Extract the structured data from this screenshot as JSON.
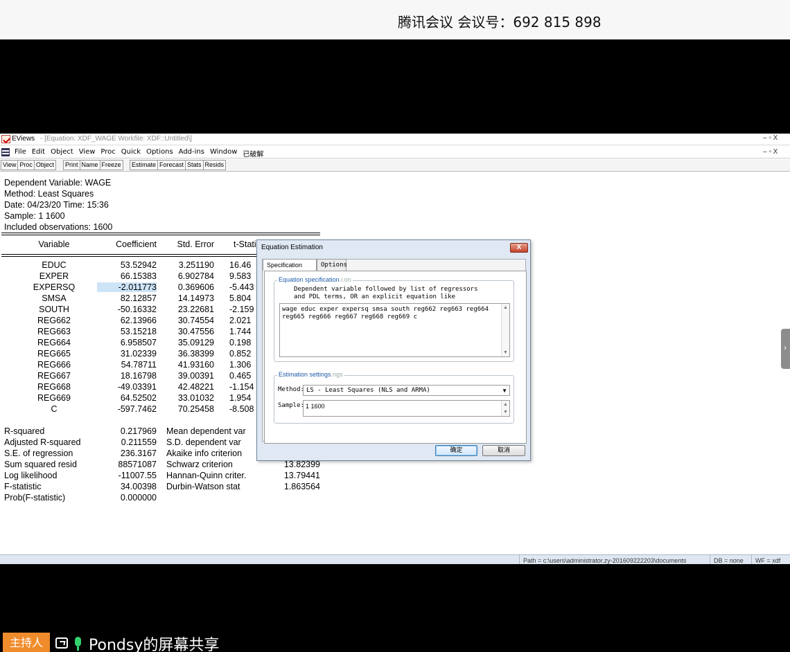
{
  "meeting": {
    "title": "腾讯会议 会议号：692 815 898"
  },
  "window": {
    "app_name": "EViews",
    "title_rest": " - [Equation: XDF_WAGE   Workfile: XDF::Untitled\\]",
    "app_controls": "–  ▫  X",
    "doc_controls": "–  ▫  X"
  },
  "menu": [
    "File",
    "Edit",
    "Object",
    "View",
    "Proc",
    "Quick",
    "Options",
    "Add-ins",
    "Window",
    "已破解"
  ],
  "toolbar": {
    "group1": [
      "View",
      "Proc",
      "Object"
    ],
    "group2": [
      "Print",
      "Name",
      "Freeze"
    ],
    "group3": [
      "Estimate",
      "Forecast",
      "Stats",
      "Resids"
    ]
  },
  "output": {
    "header": [
      "Dependent Variable: WAGE",
      "Method: Least Squares",
      "Date: 04/23/20   Time: 15:36",
      "Sample: 1 1600",
      "Included observations: 1600"
    ],
    "col_headers": [
      "Variable",
      "Coefficient",
      "Std. Error",
      "t-Stati"
    ],
    "rows": [
      [
        "EDUC",
        "53.52942",
        "3.251190",
        "16.46"
      ],
      [
        "EXPER",
        "66.15383",
        "6.902784",
        "9.583"
      ],
      [
        "EXPERSQ",
        "-2.011773",
        "0.369606",
        "-5.443"
      ],
      [
        "SMSA",
        "82.12857",
        "14.14973",
        "5.804"
      ],
      [
        "SOUTH",
        "-50.16332",
        "23.22681",
        "-2.159"
      ],
      [
        "REG662",
        "62.13966",
        "30.74554",
        "2.021"
      ],
      [
        "REG663",
        "53.15218",
        "30.47556",
        "1.744"
      ],
      [
        "REG664",
        "6.958507",
        "35.09129",
        "0.198"
      ],
      [
        "REG665",
        "31.02339",
        "36.38399",
        "0.852"
      ],
      [
        "REG666",
        "54.78711",
        "41.93160",
        "1.306"
      ],
      [
        "REG667",
        "18.16798",
        "39.00391",
        "0.465"
      ],
      [
        "REG668",
        "-49.03391",
        "42.48221",
        "-1.154"
      ],
      [
        "REG669",
        "64.52502",
        "33.01032",
        "1.954"
      ],
      [
        "C",
        "-597.7462",
        "70.25458",
        "-8.508"
      ]
    ],
    "stats": [
      [
        "R-squared",
        "0.217969",
        "Mean dependent var",
        ""
      ],
      [
        "Adjusted R-squared",
        "0.211559",
        "S.D. dependent var",
        ""
      ],
      [
        "S.E. of regression",
        "236.3167",
        "Akaike info criterion",
        ""
      ],
      [
        "Sum squared resid",
        "88571087",
        "Schwarz criterion",
        "13.82399"
      ],
      [
        "Log likelihood",
        "-11007.55",
        "Hannan-Quinn criter.",
        "13.79441"
      ],
      [
        "F-statistic",
        "34.00398",
        "Durbin-Watson stat",
        "1.863564"
      ],
      [
        "Prob(F-statistic)",
        "0.000000",
        "",
        ""
      ]
    ]
  },
  "status": {
    "path": "Path = c:\\users\\administrator.zy-201609222203\\documents",
    "db": "DB = none",
    "wf": "WF = xdf"
  },
  "dialog": {
    "title": "Equation Estimation",
    "close": "X",
    "tabs": [
      "Specification",
      "Options"
    ],
    "spec_group": "Equation specification",
    "spec_instructions": [
      "Dependent variable followed by list of regressors",
      "and PDL terms, OR an explicit equation like"
    ],
    "equation_lines": [
      "wage educ exper expersq smsa south  reg662 reg663 reg664",
      "reg665 reg666 reg667 reg668 reg669 c"
    ],
    "settings_group": "Estimation settings",
    "method_label": "Method:",
    "method_value": "LS  -  Least Squares (NLS and ARMA)",
    "sample_label": "Sample:",
    "sample_value": "1 1600",
    "ok": "确定",
    "cancel": "取消"
  },
  "share_bar": {
    "host_badge": "主持人",
    "share_text": "Pondsy的屏幕共享"
  },
  "colors": {
    "host_badge": "#f08c2c",
    "mic": "#35d06e",
    "selection": "#cde4f7",
    "dialog_bg": "#dfe8f3"
  }
}
